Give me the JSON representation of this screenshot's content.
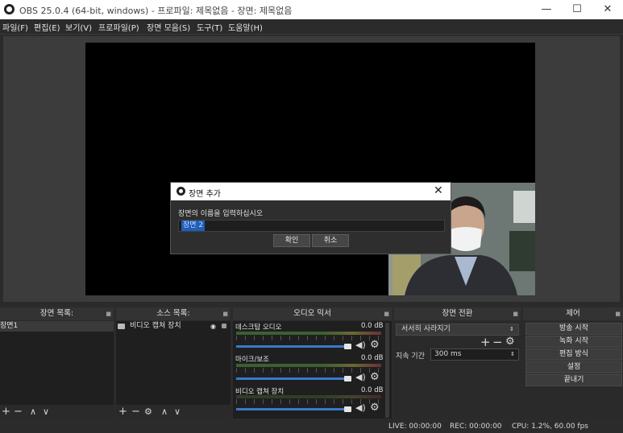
{
  "window": {
    "title": "OBS 25.0.4 (64-bit, windows) - 프로파일: 제목없음 - 장면: 제목없음",
    "minimize": "—",
    "maximize": "☐",
    "close": "✕"
  },
  "menu": [
    "파일(F)",
    "편집(E)",
    "보기(V)",
    "프로파일(P)",
    "장면 모음(S)",
    "도구(T)",
    "도움말(H)"
  ],
  "dialog": {
    "title": "장면 추가",
    "prompt": "장면의 이름을 입력하십시오",
    "input_value": "장면 2",
    "ok_label": "확인",
    "cancel_label": "취소",
    "close": "✕"
  },
  "docks": {
    "scenes": {
      "title": "장면 목록:",
      "items": [
        "장면1"
      ]
    },
    "sources": {
      "title": "소스 목록:",
      "items": [
        "비디오 캡쳐 장치"
      ]
    },
    "mixer": {
      "title": "오디오 믹서",
      "channels": [
        {
          "name": "데스크탑 오디오",
          "db": "0.0 dB"
        },
        {
          "name": "마이크/보조",
          "db": "0.0 dB"
        },
        {
          "name": "비디오 캡쳐 장치",
          "db": "0.0 dB"
        }
      ]
    },
    "transitions": {
      "title": "장면 전환",
      "selected": "서서히 사라지기",
      "duration_label": "지속 기간",
      "duration_value": "300 ms"
    },
    "controls": {
      "title": "제어",
      "buttons": [
        "방송 시작",
        "녹화 시작",
        "편집 방식",
        "설정",
        "끝내기"
      ]
    }
  },
  "status": {
    "live": "LIVE: 00:00:00",
    "rec": "REC: 00:00:00",
    "cpu": "CPU: 1.2%, 60.00 fps"
  },
  "icons": {
    "plus": "+",
    "minus": "−",
    "up": "∧",
    "down": "∨",
    "gear": "⚙",
    "speaker": "🔊",
    "eye": "👁",
    "lock": "🔒"
  },
  "colors": {
    "accent": "#3a78c8",
    "selection": "#1f5fb8"
  }
}
